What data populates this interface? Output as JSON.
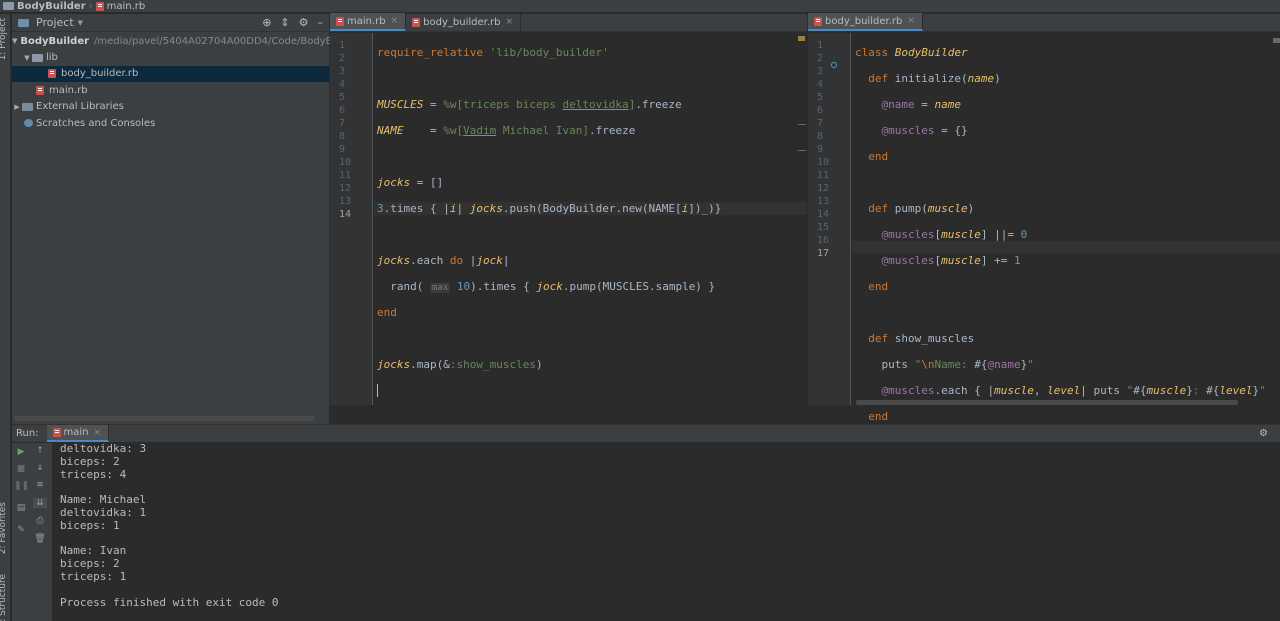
{
  "navbar": {
    "project": "BodyBuilder",
    "file": "main.rb"
  },
  "sidestripe": {
    "project": "1: Project",
    "favorites": "2: Favorites",
    "structure": "Z: Structure"
  },
  "project_panel": {
    "title": "Project",
    "tree": [
      {
        "label": "BodyBuilder",
        "path": "/media/pavel/5404A02704A00DD4/Code/BodyBuilder"
      },
      {
        "label": "lib"
      },
      {
        "label": "body_builder.rb"
      },
      {
        "label": "main.rb"
      },
      {
        "label": "External Libraries"
      },
      {
        "label": "Scratches and Consoles"
      }
    ]
  },
  "editor_left": {
    "tabs": [
      {
        "label": "main.rb"
      },
      {
        "label": "body_builder.rb"
      }
    ],
    "line_numbers": [
      "1",
      "2",
      "3",
      "4",
      "5",
      "6",
      "7",
      "8",
      "9",
      "10",
      "11",
      "12",
      "13",
      "14"
    ]
  },
  "editor_right": {
    "tabs": [
      {
        "label": "body_builder.rb"
      }
    ],
    "line_numbers": [
      "1",
      "2",
      "3",
      "4",
      "5",
      "6",
      "7",
      "8",
      "9",
      "10",
      "11",
      "12",
      "13",
      "14",
      "15",
      "16",
      "17"
    ]
  },
  "run_panel": {
    "label": "Run:",
    "tab": "main",
    "output": [
      "deltovidka: 3",
      "biceps: 2",
      "triceps: 4",
      "",
      "Name: Michael",
      "deltovidka: 1",
      "biceps: 1",
      "",
      "Name: Ivan",
      "biceps: 2",
      "triceps: 1",
      "",
      "Process finished with exit code 0"
    ]
  },
  "colors": {
    "keyword": "#cc7832",
    "string": "#6a8759",
    "instance_var": "#9876aa",
    "number": "#6897bb",
    "accent": "#4a88c7"
  }
}
